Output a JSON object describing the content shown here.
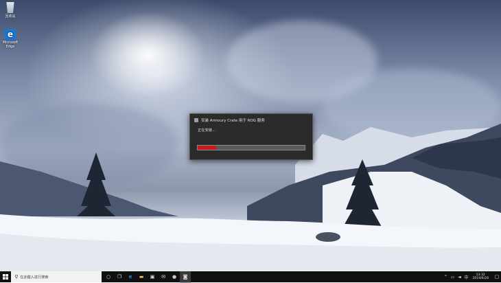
{
  "desktop": {
    "icons": [
      {
        "label": "回收站",
        "icon": "recycle-bin-icon"
      },
      {
        "label": "Microsoft Edge",
        "icon": "edge-icon"
      }
    ]
  },
  "dialog": {
    "title": "安装 Armoury Crate 用于 ROG 服务",
    "status": "正在安装...",
    "progress": 0.17,
    "progress_color": "#c41d1d"
  },
  "taskbar": {
    "search_placeholder": "在此键入进行搜索",
    "tray": {
      "time": "13:32",
      "date": "2019/6/28"
    }
  }
}
